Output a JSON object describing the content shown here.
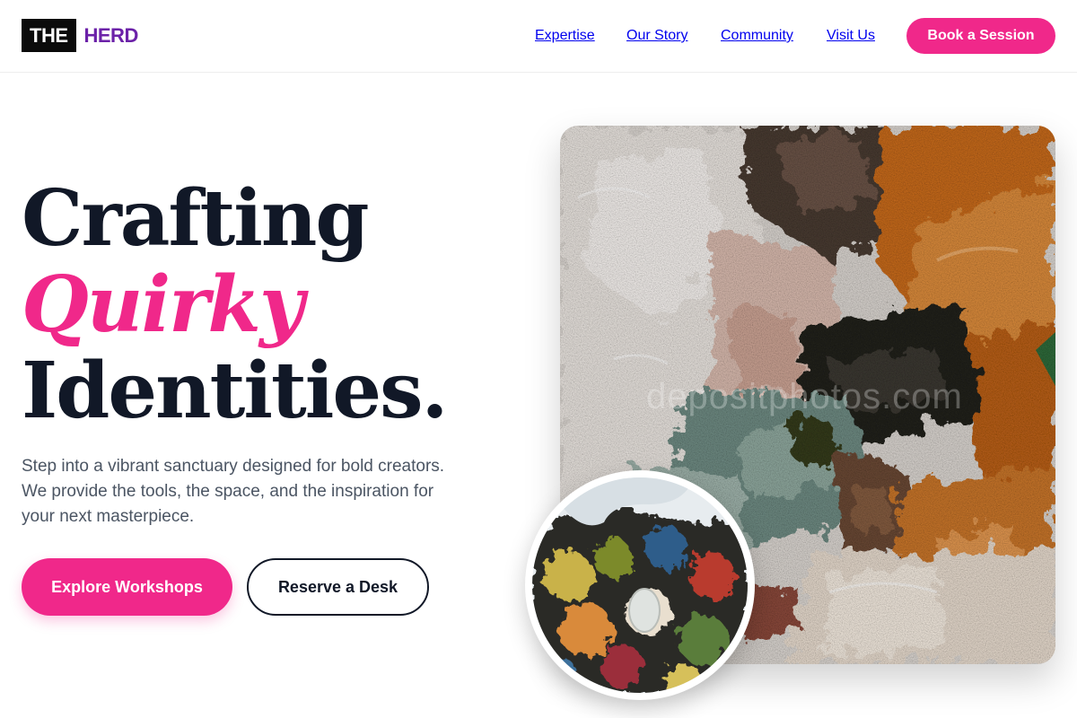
{
  "brand": {
    "box_text": "THE",
    "name": "HERD"
  },
  "nav": {
    "items": [
      {
        "label": "Expertise"
      },
      {
        "label": "Our Story"
      },
      {
        "label": "Community"
      },
      {
        "label": "Visit Us"
      }
    ],
    "cta": "Book a Session"
  },
  "hero": {
    "headline_line1": "Crafting",
    "headline_accent": "Quirky",
    "headline_line3": "Identities.",
    "subtitle": "Step into a vibrant sanctuary designed for bold creators. We provide the tools, the space, and the inspiration for your next masterpiece.",
    "primary_button": "Explore Workshops",
    "secondary_button": "Reserve a Desk"
  },
  "images": {
    "main": "textured-paint-artwork",
    "inset": "paint-palette-photo",
    "watermark": "depositphotos.com"
  },
  "colors": {
    "accent": "#f0288a",
    "brand_purple": "#6b21a8",
    "ink": "#111827",
    "muted_text": "#4b5563"
  }
}
